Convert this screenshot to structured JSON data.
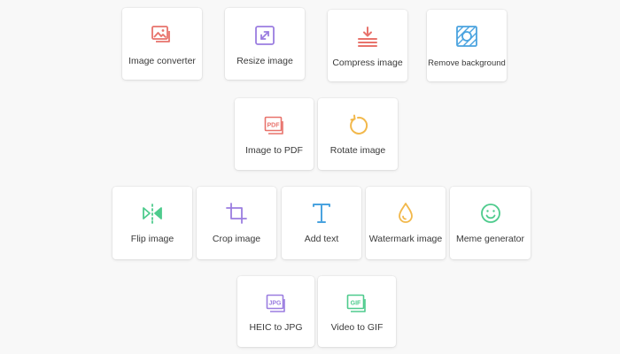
{
  "tools": {
    "image_converter": {
      "label": "Image converter",
      "icon": "images-icon",
      "color": "#e8736c"
    },
    "resize_image": {
      "label": "Resize image",
      "icon": "resize-icon",
      "color": "#9b7de0"
    },
    "compress_image": {
      "label": "Compress image",
      "icon": "compress-icon",
      "color": "#e8736c"
    },
    "remove_background": {
      "label": "Remove background",
      "icon": "remove-background-icon",
      "color": "#4aa3df"
    },
    "image_to_pdf": {
      "label": "Image to PDF",
      "icon": "pdf-icon",
      "color": "#e8736c"
    },
    "rotate_image": {
      "label": "Rotate image",
      "icon": "rotate-icon",
      "color": "#f2b84b"
    },
    "flip_image": {
      "label": "Flip image",
      "icon": "flip-icon",
      "color": "#4ecb8d"
    },
    "crop_image": {
      "label": "Crop image",
      "icon": "crop-icon",
      "color": "#9b7de0"
    },
    "add_text": {
      "label": "Add text",
      "icon": "text-icon",
      "color": "#4aa3df"
    },
    "watermark_image": {
      "label": "Watermark image",
      "icon": "droplet-icon",
      "color": "#f2b84b"
    },
    "meme_generator": {
      "label": "Meme generator",
      "icon": "smiley-icon",
      "color": "#4ecb8d"
    },
    "heic_to_jpg": {
      "label": "HEIC to JPG",
      "icon": "jpg-icon",
      "color": "#9b7de0"
    },
    "video_to_gif": {
      "label": "Video to GIF",
      "icon": "gif-icon",
      "color": "#4ecb8d"
    }
  }
}
